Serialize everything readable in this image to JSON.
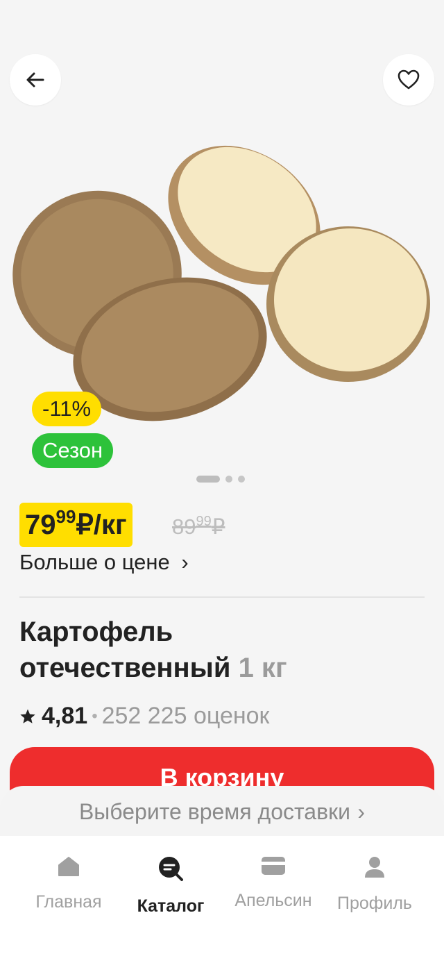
{
  "header": {
    "back_icon": "arrow-left-icon",
    "favorite_icon": "heart-icon"
  },
  "badges": {
    "discount": "-11%",
    "season": "Сезон"
  },
  "carousel": {
    "total": 3,
    "active": 0
  },
  "price": {
    "main": "79",
    "cents": "99",
    "unit": "₽/кг",
    "old_main": "89",
    "old_cents": "99",
    "old_currency": "₽"
  },
  "price_more": {
    "label": "Больше о цене",
    "chevron": "›"
  },
  "product": {
    "name_line1": "Картофель",
    "name_line2": "отечественный",
    "weight": "1 кг"
  },
  "rating": {
    "value": "4,81",
    "separator": "•",
    "count": "252 225 оценок"
  },
  "cart": {
    "label": "В корзину",
    "color": "#ee2d2d"
  },
  "delivery": {
    "label": "Выберите время доставки",
    "chevron": "›"
  },
  "nav": {
    "items": [
      {
        "label": "Главная",
        "icon": "home-icon"
      },
      {
        "label": "Каталог",
        "icon": "catalog-search-icon"
      },
      {
        "label": "Апельсин",
        "icon": "card-icon"
      },
      {
        "label": "Профиль",
        "icon": "profile-icon"
      }
    ]
  },
  "colors": {
    "yellow": "#ffde00",
    "green": "#2dc23a",
    "red": "#ee2d2d"
  }
}
